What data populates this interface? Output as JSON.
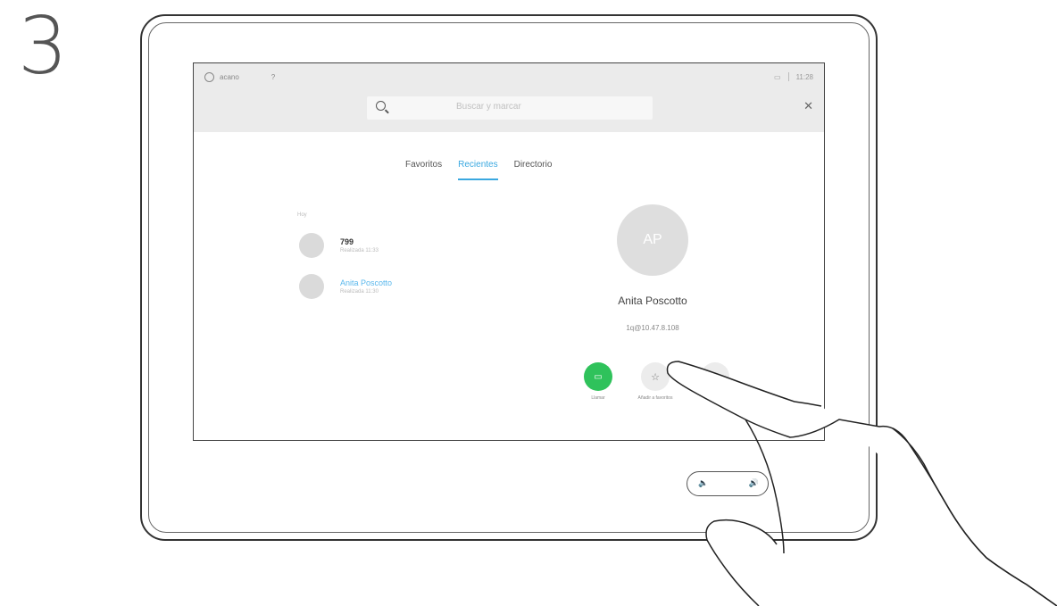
{
  "step": "3",
  "statusbar": {
    "left_text": "acano",
    "right_time": "11:28"
  },
  "search": {
    "placeholder": "Buscar y marcar"
  },
  "tabs": [
    "Favoritos",
    "Recientes",
    "Directorio"
  ],
  "list": {
    "header": "Hoy",
    "items": [
      {
        "name": "799",
        "sub": "Realizada 11:33"
      },
      {
        "name": "Anita Poscotto",
        "sub": "Realizada 11:30"
      }
    ]
  },
  "contact": {
    "initials": "AP",
    "name": "Anita Poscotto",
    "address": "1q@10.47.8.108"
  },
  "actions": {
    "call": "Llamar",
    "fav": "Añadir a favoritos"
  },
  "colors": {
    "accent": "#3aa8e0",
    "call": "#2fc25b"
  }
}
